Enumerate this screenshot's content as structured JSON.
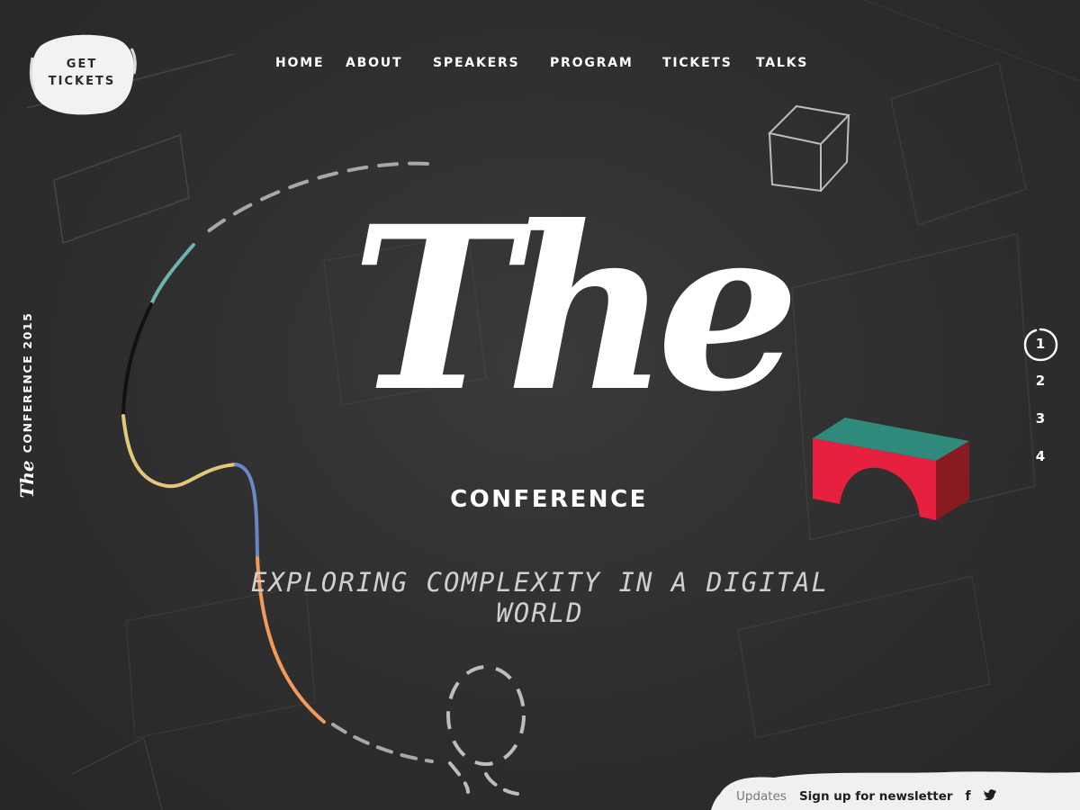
{
  "header": {
    "cta": {
      "line1": "GET",
      "line2": "TICKETS"
    },
    "nav": [
      {
        "label": "HOME"
      },
      {
        "label": "ABOUT"
      },
      {
        "label": "SPEAKERS"
      },
      {
        "label": "PROGRAM"
      },
      {
        "label": "TICKETS"
      },
      {
        "label": "TALKS"
      }
    ]
  },
  "side": {
    "the": "The",
    "text": "CONFERENCE 2015"
  },
  "hero": {
    "title": "The",
    "subtitle": "CONFERENCE",
    "tagline": "EXPLORING COMPLEXITY IN A DIGITAL WORLD"
  },
  "pager": {
    "items": [
      "1",
      "2",
      "3",
      "4"
    ],
    "active": "1"
  },
  "footer": {
    "updates": "Updates",
    "signup": "Sign up for newsletter",
    "facebook_glyph": "f",
    "twitter_glyph": "❝"
  },
  "icons": {
    "chalk_cube": "cube-sketch-icon",
    "arch_block": "arch-block-icon",
    "facebook": "facebook-icon",
    "twitter": "twitter-icon"
  },
  "colors": {
    "board": "#2e2e2e",
    "chalk": "#ffffff",
    "arch_top": "#2f8a7c",
    "arch_front": "#e8203f",
    "arch_side": "#8a1a22",
    "path_teal": "#6fb3b0",
    "path_black": "#111111",
    "path_yellow": "#e5c77a",
    "path_blue": "#6b86c7",
    "path_orange": "#f29a5c"
  }
}
